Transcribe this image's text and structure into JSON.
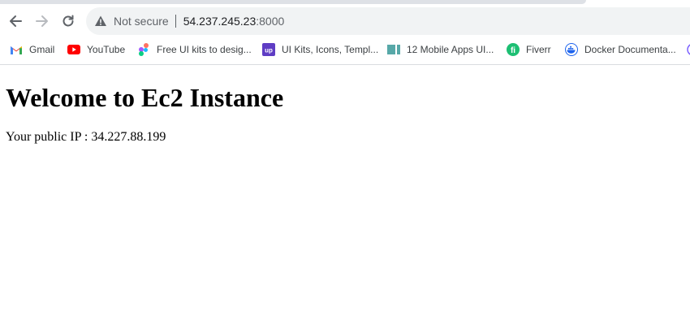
{
  "browser": {
    "security_label": "Not secure",
    "url_host": "54.237.245.23",
    "url_port": ":8000",
    "bookmarks": [
      {
        "label": "Gmail",
        "icon": "gmail-icon"
      },
      {
        "label": "YouTube",
        "icon": "youtube-icon"
      },
      {
        "label": "Free UI kits to desig...",
        "icon": "figma-icon"
      },
      {
        "label": "UI Kits, Icons, Templ...",
        "icon": "uplabs-icon"
      },
      {
        "label": "12 Mobile Apps UI...",
        "icon": "bookmark-site-icon"
      },
      {
        "label": "Fiverr",
        "icon": "fiverr-icon"
      },
      {
        "label": "Docker Documenta...",
        "icon": "docker-icon"
      }
    ],
    "colors": {
      "toolbar_bg": "#ffffff",
      "omnibox_bg": "#f1f3f4",
      "youtube_red": "#ff0000",
      "fiverr_green": "#1dbf73",
      "uplabs_purple": "#5f3dc4"
    }
  },
  "page": {
    "heading": "Welcome to Ec2 Instance",
    "ip_text": "Your public IP : 34.227.88.199"
  }
}
